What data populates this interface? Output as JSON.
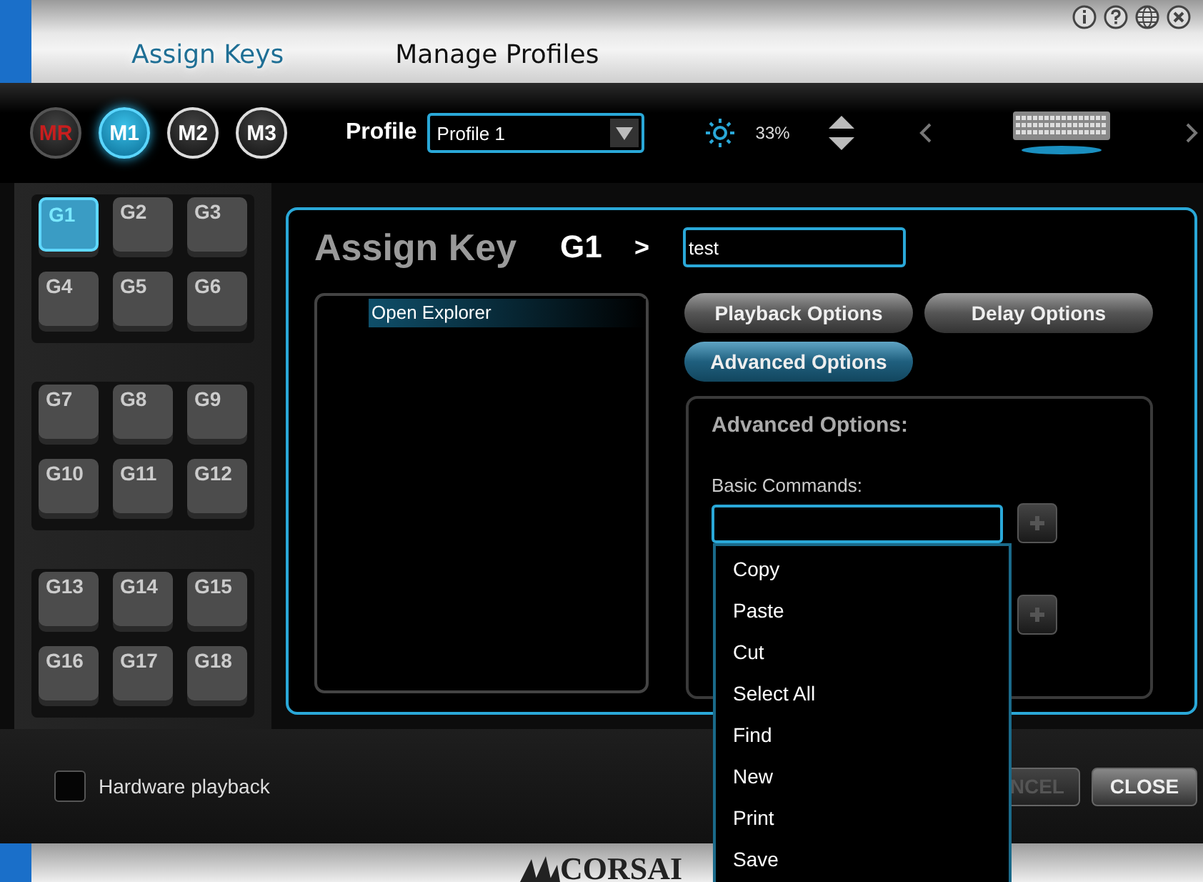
{
  "tabs": [
    {
      "label": "Assign Keys",
      "selected": true
    },
    {
      "label": "Manage Profiles",
      "selected": false
    }
  ],
  "mode_buttons": [
    {
      "label": "MR",
      "kind": "record",
      "selected": false
    },
    {
      "label": "M1",
      "kind": "mode",
      "selected": true
    },
    {
      "label": "M2",
      "kind": "mode",
      "selected": false
    },
    {
      "label": "M3",
      "kind": "mode",
      "selected": false
    }
  ],
  "profile": {
    "label": "Profile",
    "value": "Profile 1"
  },
  "brightness": {
    "reading": "33%"
  },
  "g_key_groups": [
    [
      {
        "label": "G1",
        "selected": true
      },
      {
        "label": "G2",
        "selected": false
      },
      {
        "label": "G3",
        "selected": false
      },
      {
        "label": "G4",
        "selected": false
      },
      {
        "label": "G5",
        "selected": false
      },
      {
        "label": "G6",
        "selected": false
      }
    ],
    [
      {
        "label": "G7",
        "selected": false
      },
      {
        "label": "G8",
        "selected": false
      },
      {
        "label": "G9",
        "selected": false
      },
      {
        "label": "G10",
        "selected": false
      },
      {
        "label": "G11",
        "selected": false
      },
      {
        "label": "G12",
        "selected": false
      }
    ],
    [
      {
        "label": "G13",
        "selected": false
      },
      {
        "label": "G14",
        "selected": false
      },
      {
        "label": "G15",
        "selected": false
      },
      {
        "label": "G16",
        "selected": false
      },
      {
        "label": "G17",
        "selected": false
      },
      {
        "label": "G18",
        "selected": false
      }
    ]
  ],
  "assign": {
    "title": "Assign Key",
    "key": "G1",
    "arrow": ">",
    "name": "test"
  },
  "macro_list": [
    {
      "label": "Open Explorer",
      "selected": true
    }
  ],
  "option_buttons": [
    {
      "label": "Playback Options",
      "selected": false
    },
    {
      "label": "Delay Options",
      "selected": false
    },
    {
      "label": "Advanced Options",
      "selected": true
    }
  ],
  "advanced": {
    "title": "Advanced Options:",
    "basic_commands_label": "Basic Commands:"
  },
  "dropdown": {
    "items": [
      "Copy",
      "Paste",
      "Cut",
      "Select All",
      "Find",
      "New",
      "Print",
      "Save"
    ]
  },
  "hardware_playback": {
    "label": "Hardware playback",
    "checked": false
  },
  "buttons": [
    "NCEL",
    "CLOSE"
  ],
  "logo": "CORSAI"
}
